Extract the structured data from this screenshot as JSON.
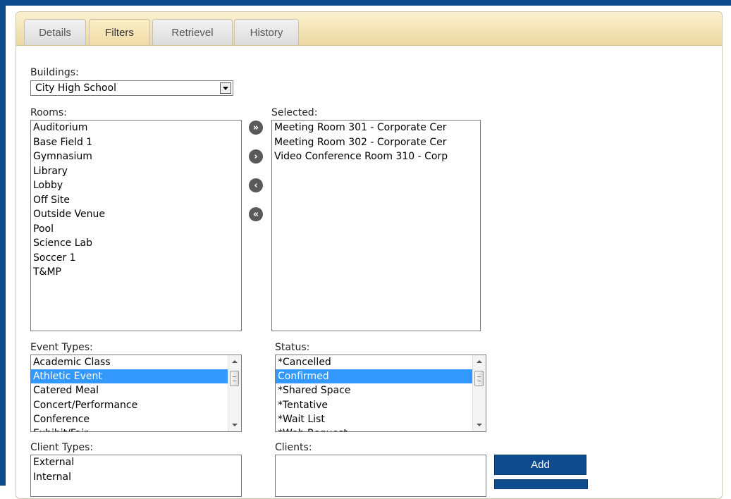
{
  "tabs": [
    "Details",
    "Filters",
    "Retrievel",
    "History"
  ],
  "active_tab": "Filters",
  "buildings": {
    "label": "Buildings:",
    "value": "City High School"
  },
  "rooms": {
    "label": "Rooms:",
    "items": [
      "Auditorium",
      "Base Field 1",
      "Gymnasium",
      "Library",
      "Lobby",
      "Off Site",
      "Outside Venue",
      "Pool",
      "Science Lab",
      "Soccer 1",
      "T&MP"
    ]
  },
  "selected": {
    "label": "Selected:",
    "items": [
      "Meeting Room 301 - Corporate Cer",
      "Meeting Room 302 - Corporate Cer",
      "Video Conference Room 310 - Corp"
    ]
  },
  "move_buttons": {
    "add_all": "»",
    "add_one": "›",
    "remove_one": "‹",
    "remove_all": "«"
  },
  "event_types": {
    "label": "Event Types:",
    "items": [
      "Academic Class",
      "Athletic Event",
      "Catered Meal",
      "Concert/Performance",
      "Conference",
      "Exhibit/Fair"
    ],
    "selected": "Athletic Event"
  },
  "status": {
    "label": "Status:",
    "items": [
      "*Cancelled",
      "Confirmed",
      "*Shared Space",
      "*Tentative",
      "*Wait List",
      "*Web Request"
    ],
    "selected": "Confirmed"
  },
  "client_types": {
    "label": "Client Types:",
    "items": [
      "External",
      "Internal"
    ]
  },
  "clients": {
    "label": "Clients:",
    "add_label": "Add"
  },
  "colors": {
    "accent": "#0e4c8f",
    "selection": "#3399ff",
    "tabbar": "#ecd9a3"
  }
}
